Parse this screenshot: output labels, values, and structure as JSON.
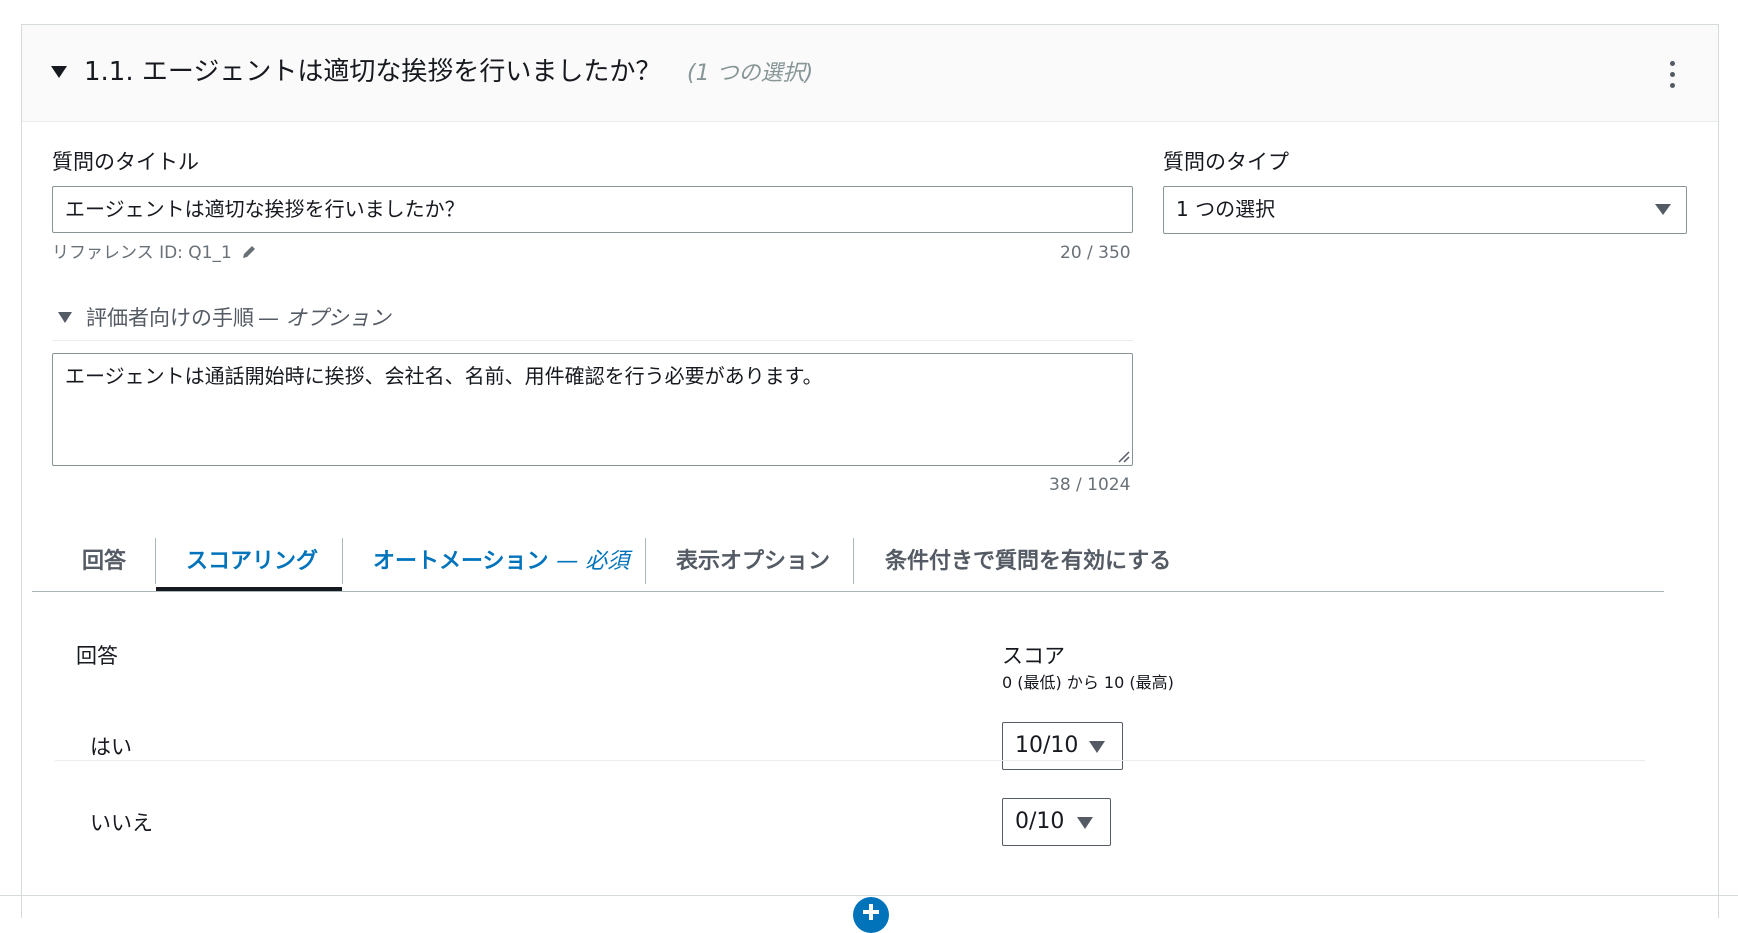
{
  "question": {
    "header_title": "1.1. エージェントは適切な挨拶を行いましたか？",
    "header_type_hint": "(1 つの選択)"
  },
  "title_field": {
    "label": "質問のタイトル",
    "value": "エージェントは適切な挨拶を行いましたか？",
    "reference_id": "リファレンス ID: Q1_1",
    "char_count": "20 / 350"
  },
  "type_field": {
    "label": "質問のタイプ",
    "value": "1 つの選択"
  },
  "instructions": {
    "label": "評価者向けの手順",
    "optional_suffix": "— オプション",
    "value": "エージェントは通話開始時に挨拶、会社名、名前、用件確認を行う必要があります。",
    "char_count": "38 / 1024"
  },
  "tabs": [
    {
      "label": "回答"
    },
    {
      "label": "スコアリング"
    },
    {
      "label": "オートメーション",
      "suffix": "— 必須"
    },
    {
      "label": "表示オプション"
    },
    {
      "label": "条件付きで質問を有効にする"
    }
  ],
  "active_tab": "スコアリング",
  "scoring": {
    "answer_header": "回答",
    "score_header": "スコア",
    "score_range": "0 (最低) から 10 (最高)",
    "rows": [
      {
        "answer": "はい",
        "score": "10/10"
      },
      {
        "answer": "いいえ",
        "score": "0/10"
      }
    ]
  },
  "colors": {
    "accent": "#0073bb",
    "text": "#16191f",
    "muted": "#687078",
    "border": "#879596",
    "header_bg": "#fafafa"
  },
  "icons": [
    "caret-down-icon",
    "kebab-menu-icon",
    "pencil-icon",
    "resize-grip-icon",
    "add-icon"
  ]
}
